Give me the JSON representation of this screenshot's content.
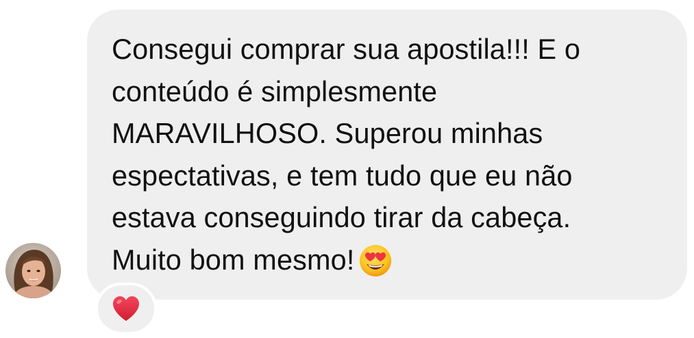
{
  "message": {
    "lines": [
      "Consegui comprar sua apostila!!! E o",
      "conteúdo é simplesmente",
      "MARAVILHOSO. Superou minhas",
      "espectativas, e tem tudo que eu não",
      "estava conseguindo tirar da cabeça.",
      "Muito bom mesmo!"
    ],
    "emoji": "heart-eyes-emoji"
  },
  "reaction": {
    "icon": "heart-icon",
    "color": "#e0253b"
  },
  "sender": {
    "avatar_icon": "avatar"
  },
  "colors": {
    "bubble_background": "#efefef",
    "text": "#111111",
    "page_background": "#ffffff"
  }
}
